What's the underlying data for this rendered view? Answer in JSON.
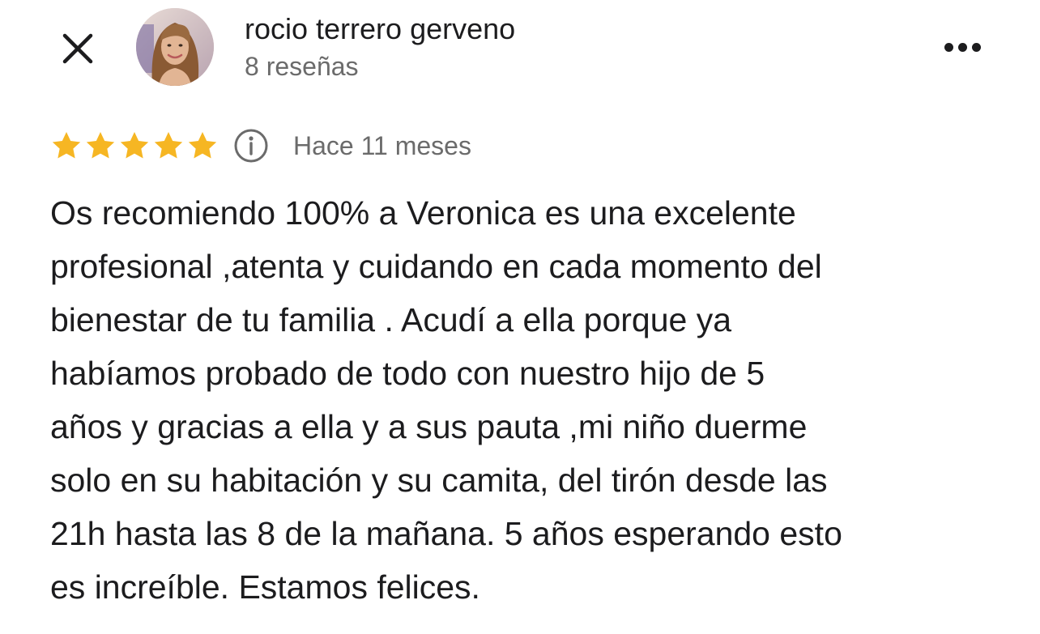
{
  "header": {
    "author_name": "rocio terrero gerveno",
    "review_count": "8 reseñas",
    "close_icon": "close-icon",
    "more_icon": "more-horizontal-icon"
  },
  "review": {
    "rating": 5,
    "rating_max": 5,
    "star_color": "#f6b623",
    "info_icon": "info-icon",
    "time_ago": "Hace 11 meses",
    "text_lines": [
      "Os recomiendo 100% a Veronica es una excelente",
      "profesional ,atenta  y cuidando en cada momento del",
      "bienestar de tu familia . Acudí a ella porque ya",
      "habíamos probado de todo con nuestro hijo de 5",
      "años y gracias a ella y a sus pauta ,mi niño duerme",
      "solo en su habitación y su camita, del  tirón desde las",
      "21h hasta las 8 de la mañana. 5 años esperando esto",
      "es increíble. Estamos felices."
    ]
  }
}
